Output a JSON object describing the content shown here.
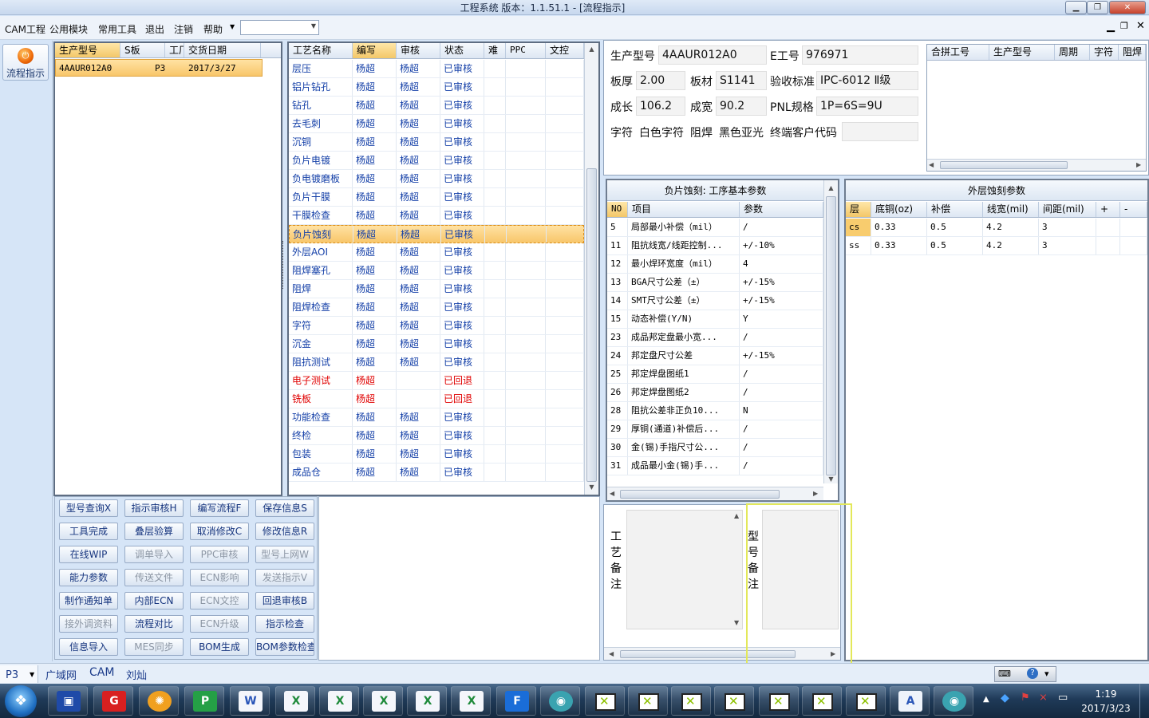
{
  "window": {
    "title": "工程系统   版本：1.1.51.1 - [流程指示]"
  },
  "menu": {
    "items": [
      "CAM工程",
      "公用模块",
      "常用工具",
      "退出",
      "注销",
      "帮助"
    ],
    "combo_value": ""
  },
  "sidebar": {
    "flow_button": "流程指示"
  },
  "model_list": {
    "columns": [
      "生产型号",
      "S板",
      "工厂",
      "交货日期"
    ],
    "rows": [
      {
        "model": "4AAUR012A0",
        "s": "",
        "factory": "P3",
        "date": "2017/3/27"
      }
    ]
  },
  "process": {
    "columns": [
      "工艺名称",
      "编写",
      "审核",
      "状态",
      "难",
      "PPC",
      "文控"
    ],
    "rows": [
      {
        "name": "层压",
        "writer": "杨超",
        "reviewer": "杨超",
        "status": "已审核",
        "flag": "ok"
      },
      {
        "name": "铝片钻孔",
        "writer": "杨超",
        "reviewer": "杨超",
        "status": "已审核",
        "flag": "ok"
      },
      {
        "name": "钻孔",
        "writer": "杨超",
        "reviewer": "杨超",
        "status": "已审核",
        "flag": "ok"
      },
      {
        "name": "去毛刺",
        "writer": "杨超",
        "reviewer": "杨超",
        "status": "已审核",
        "flag": "ok"
      },
      {
        "name": "沉铜",
        "writer": "杨超",
        "reviewer": "杨超",
        "status": "已审核",
        "flag": "ok"
      },
      {
        "name": "负片电镀",
        "writer": "杨超",
        "reviewer": "杨超",
        "status": "已审核",
        "flag": "ok"
      },
      {
        "name": "负电镀磨板",
        "writer": "杨超",
        "reviewer": "杨超",
        "status": "已审核",
        "flag": "ok"
      },
      {
        "name": "负片干膜",
        "writer": "杨超",
        "reviewer": "杨超",
        "status": "已审核",
        "flag": "ok"
      },
      {
        "name": "干膜检查",
        "writer": "杨超",
        "reviewer": "杨超",
        "status": "已审核",
        "flag": "ok"
      },
      {
        "name": "负片蚀刻",
        "writer": "杨超",
        "reviewer": "杨超",
        "status": "已审核",
        "flag": "selected"
      },
      {
        "name": "外层AOI",
        "writer": "杨超",
        "reviewer": "杨超",
        "status": "已审核",
        "flag": "ok"
      },
      {
        "name": "阻焊塞孔",
        "writer": "杨超",
        "reviewer": "杨超",
        "status": "已审核",
        "flag": "ok"
      },
      {
        "name": "阻焊",
        "writer": "杨超",
        "reviewer": "杨超",
        "status": "已审核",
        "flag": "ok"
      },
      {
        "name": "阻焊检查",
        "writer": "杨超",
        "reviewer": "杨超",
        "status": "已审核",
        "flag": "ok"
      },
      {
        "name": "字符",
        "writer": "杨超",
        "reviewer": "杨超",
        "status": "已审核",
        "flag": "ok"
      },
      {
        "name": "沉金",
        "writer": "杨超",
        "reviewer": "杨超",
        "status": "已审核",
        "flag": "ok"
      },
      {
        "name": "阻抗测试",
        "writer": "杨超",
        "reviewer": "杨超",
        "status": "已审核",
        "flag": "ok"
      },
      {
        "name": "电子测试",
        "writer": "杨超",
        "reviewer": "",
        "status": "已回退",
        "flag": "returned"
      },
      {
        "name": "铣板",
        "writer": "杨超",
        "reviewer": "",
        "status": "已回退",
        "flag": "returned"
      },
      {
        "name": "功能检查",
        "writer": "杨超",
        "reviewer": "杨超",
        "status": "已审核",
        "flag": "ok"
      },
      {
        "name": "终检",
        "writer": "杨超",
        "reviewer": "杨超",
        "status": "已审核",
        "flag": "ok"
      },
      {
        "name": "包装",
        "writer": "杨超",
        "reviewer": "杨超",
        "status": "已审核",
        "flag": "ok"
      },
      {
        "name": "成品仓",
        "writer": "杨超",
        "reviewer": "杨超",
        "status": "已审核",
        "flag": "ok"
      }
    ]
  },
  "actions": [
    [
      "型号查询X",
      "指示审核H",
      "编写流程F",
      "保存信息S"
    ],
    [
      "工具完成",
      "叠层验算",
      "取消修改C",
      "修改信息R"
    ],
    [
      "在线WIP",
      "调单导入",
      "PPC审核",
      "型号上网W"
    ],
    [
      "能力参数",
      "传送文件",
      "ECN影响",
      "发送指示V"
    ],
    [
      "制作通知单",
      "内部ECN",
      "ECN文控",
      "回退审核B"
    ],
    [
      "接外调资料",
      "流程对比",
      "ECN升级",
      "指示检查"
    ],
    [
      "信息导入",
      "MES同步",
      "BOM生成",
      "BOM参数检查"
    ]
  ],
  "actions_disabled": [
    "调单导入",
    "PPC审核",
    "型号上网W",
    "传送文件",
    "ECN影响",
    "发送指示V",
    "ECN文控",
    "接外调资料",
    "ECN升级",
    "MES同步"
  ],
  "info": {
    "model_label": "生产型号",
    "model": "4AAUR012A0",
    "ework_label": "E工号",
    "ework": "976971",
    "thickness_label": "板厚",
    "thickness": "2.00",
    "material_label": "板材",
    "material": "S1141",
    "standard_label": "验收标准",
    "standard": "IPC-6012 Ⅱ级",
    "length_label": "成长",
    "length": "106.2",
    "width_label": "成宽",
    "width": "90.2",
    "pnl_label": "PNL规格",
    "pnl": "1P=6S=9U",
    "char_label": "字符",
    "char": "白色字符",
    "mask_label": "阻焊",
    "mask": "黑色亚光",
    "customer_label": "终端客户代码",
    "customer": ""
  },
  "merge": {
    "columns": [
      "合拼工号",
      "生产型号",
      "周期",
      "字符",
      "阻焊"
    ]
  },
  "basic_params": {
    "title": "负片蚀刻: 工序基本参数",
    "columns": [
      "NO",
      "项目",
      "参数"
    ],
    "rows": [
      {
        "no": "5",
        "item": "局部最小补偿（mil）",
        "param": "/"
      },
      {
        "no": "11",
        "item": "阻抗线宽/线距控制...",
        "param": "+/-10%"
      },
      {
        "no": "12",
        "item": "最小焊环宽度（mil）",
        "param": "4"
      },
      {
        "no": "13",
        "item": "BGA尺寸公差（±）",
        "param": "+/-15%"
      },
      {
        "no": "14",
        "item": "SMT尺寸公差（±）",
        "param": "+/-15%"
      },
      {
        "no": "15",
        "item": "动态补偿(Y/N)",
        "param": "Y"
      },
      {
        "no": "23",
        "item": "成品邦定盘最小宽...",
        "param": "/"
      },
      {
        "no": "24",
        "item": "邦定盘尺寸公差",
        "param": "+/-15%"
      },
      {
        "no": "25",
        "item": "邦定焊盘图纸1",
        "param": "/"
      },
      {
        "no": "26",
        "item": "邦定焊盘图纸2",
        "param": "/"
      },
      {
        "no": "28",
        "item": "阻抗公差非正负10...",
        "param": "N"
      },
      {
        "no": "29",
        "item": "厚铜(通道)补偿后...",
        "param": "/"
      },
      {
        "no": "30",
        "item": "金(锡)手指尺寸公...",
        "param": "/"
      },
      {
        "no": "31",
        "item": "成品最小金(锡)手...",
        "param": "/"
      }
    ]
  },
  "outer_params": {
    "title": "外层蚀刻参数",
    "columns": [
      "层",
      "底铜(oz)",
      "补偿",
      "线宽(mil)",
      "间距(mil)",
      "+",
      "-"
    ],
    "rows": [
      {
        "layer": "cs",
        "copper": "0.33",
        "comp": "0.5",
        "width": "4.2",
        "space": "3"
      },
      {
        "layer": "ss",
        "copper": "0.33",
        "comp": "0.5",
        "width": "4.2",
        "space": "3"
      }
    ]
  },
  "notes": {
    "process_label": "工艺备注",
    "model_label": "型号备注"
  },
  "status": {
    "factory": "P3",
    "net": "广域网",
    "dept": "CAM",
    "user": "刘灿"
  },
  "taskbar": {
    "time": "1:19",
    "date": "2017/3/23"
  }
}
